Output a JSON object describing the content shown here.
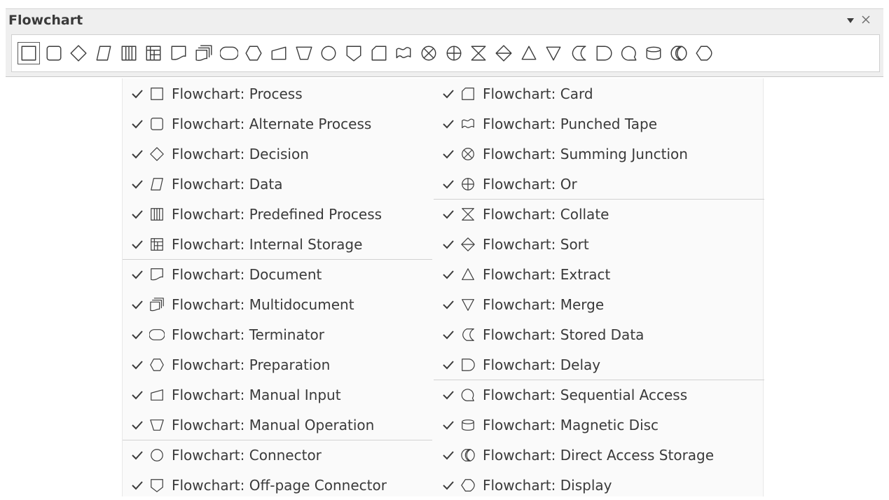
{
  "toolbar": {
    "title": "Flowchart",
    "shapes": [
      {
        "icon": "process"
      },
      {
        "icon": "alternate-process"
      },
      {
        "icon": "decision"
      },
      {
        "icon": "data"
      },
      {
        "icon": "predefined-process"
      },
      {
        "icon": "internal-storage"
      },
      {
        "icon": "document"
      },
      {
        "icon": "multidocument"
      },
      {
        "icon": "terminator"
      },
      {
        "icon": "preparation"
      },
      {
        "icon": "manual-input"
      },
      {
        "icon": "manual-operation"
      },
      {
        "icon": "connector"
      },
      {
        "icon": "off-page-connector"
      },
      {
        "icon": "card"
      },
      {
        "icon": "punched-tape"
      },
      {
        "icon": "summing-junction"
      },
      {
        "icon": "or"
      },
      {
        "icon": "collate"
      },
      {
        "icon": "sort"
      },
      {
        "icon": "extract"
      },
      {
        "icon": "merge"
      },
      {
        "icon": "stored-data"
      },
      {
        "icon": "delay"
      },
      {
        "icon": "sequential-access"
      },
      {
        "icon": "magnetic-disc"
      },
      {
        "icon": "direct-access-storage"
      },
      {
        "icon": "display"
      }
    ]
  },
  "menu": {
    "left": [
      {
        "icon": "process",
        "label": "Flowchart: Process",
        "checked": true
      },
      {
        "icon": "alternate-process",
        "label": "Flowchart: Alternate Process",
        "checked": true
      },
      {
        "icon": "decision",
        "label": "Flowchart: Decision",
        "checked": true
      },
      {
        "icon": "data",
        "label": "Flowchart: Data",
        "checked": true
      },
      {
        "icon": "predefined-process",
        "label": "Flowchart: Predefined Process",
        "checked": true
      },
      {
        "icon": "internal-storage",
        "label": "Flowchart: Internal Storage",
        "checked": true,
        "separator_after": true
      },
      {
        "icon": "document",
        "label": "Flowchart: Document",
        "checked": true
      },
      {
        "icon": "multidocument",
        "label": "Flowchart: Multidocument",
        "checked": true
      },
      {
        "icon": "terminator",
        "label": "Flowchart: Terminator",
        "checked": true
      },
      {
        "icon": "preparation",
        "label": "Flowchart: Preparation",
        "checked": true
      },
      {
        "icon": "manual-input",
        "label": "Flowchart: Manual Input",
        "checked": true
      },
      {
        "icon": "manual-operation",
        "label": "Flowchart: Manual Operation",
        "checked": true,
        "separator_after": true
      },
      {
        "icon": "connector",
        "label": "Flowchart: Connector",
        "checked": true
      },
      {
        "icon": "off-page-connector",
        "label": "Flowchart: Off-page Connector",
        "checked": true
      }
    ],
    "right": [
      {
        "icon": "card",
        "label": "Flowchart: Card",
        "checked": true
      },
      {
        "icon": "punched-tape",
        "label": "Flowchart: Punched Tape",
        "checked": true
      },
      {
        "icon": "summing-junction",
        "label": "Flowchart: Summing Junction",
        "checked": true
      },
      {
        "icon": "or",
        "label": "Flowchart: Or",
        "checked": true,
        "separator_after": true
      },
      {
        "icon": "collate",
        "label": "Flowchart: Collate",
        "checked": true
      },
      {
        "icon": "sort",
        "label": "Flowchart: Sort",
        "checked": true
      },
      {
        "icon": "extract",
        "label": "Flowchart: Extract",
        "checked": true
      },
      {
        "icon": "merge",
        "label": "Flowchart: Merge",
        "checked": true
      },
      {
        "icon": "stored-data",
        "label": "Flowchart: Stored Data",
        "checked": true
      },
      {
        "icon": "delay",
        "label": "Flowchart: Delay",
        "checked": true,
        "separator_after": true
      },
      {
        "icon": "sequential-access",
        "label": "Flowchart: Sequential Access",
        "checked": true
      },
      {
        "icon": "magnetic-disc",
        "label": "Flowchart: Magnetic Disc",
        "checked": true
      },
      {
        "icon": "direct-access-storage",
        "label": "Flowchart: Direct Access Storage",
        "checked": true
      },
      {
        "icon": "display",
        "label": "Flowchart: Display",
        "checked": true
      }
    ]
  }
}
